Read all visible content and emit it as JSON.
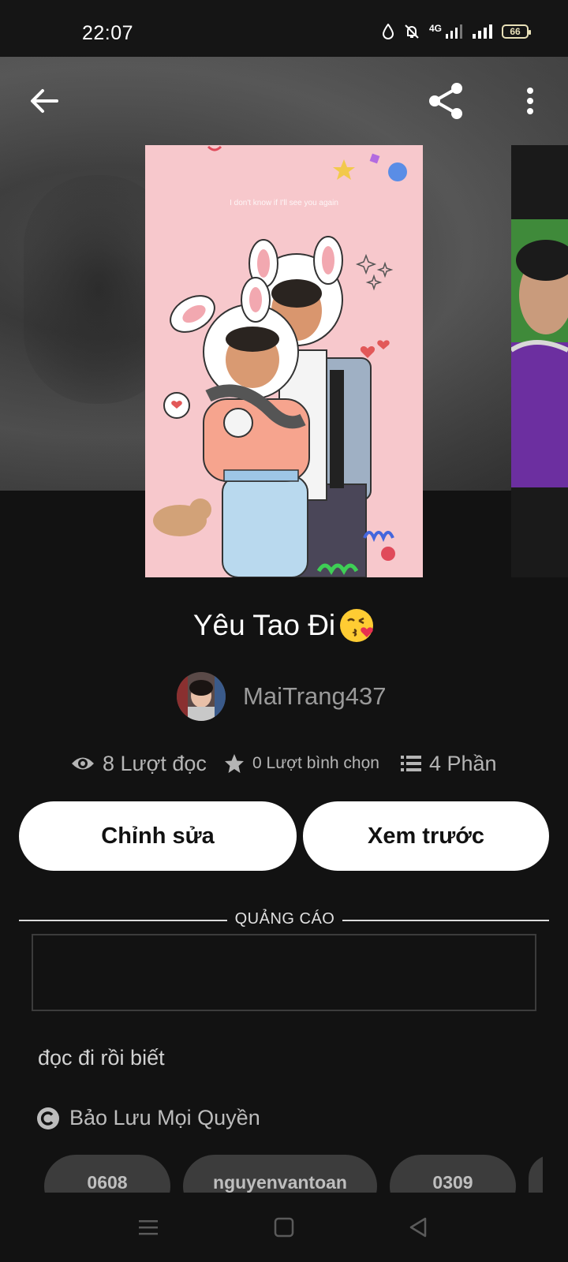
{
  "status_bar": {
    "time": "22:07",
    "network": "4G",
    "battery": "66"
  },
  "top_nav": {
    "back_icon": "arrow-left-icon",
    "share_icon": "share-icon",
    "more_icon": "more-vertical-icon"
  },
  "cover": {
    "caption": "I don't know if I'll see you again"
  },
  "story": {
    "title": "Yêu Tao Đi",
    "title_emoji": "kissing-face-heart-emoji",
    "author": "MaiTrang437",
    "reads_label": "8 Lượt đọc",
    "votes_label": "0 Lượt bình chọn",
    "parts_label": "4 Phần",
    "description": "đọc đi rồi biết",
    "copyright": "Bảo Lưu Mọi Quyền"
  },
  "actions": {
    "edit_label": "Chỉnh sửa",
    "preview_label": "Xem trước"
  },
  "ad": {
    "label": "QUẢNG CÁO"
  },
  "tags": [
    "0608",
    "nguyenvantoan",
    "0309"
  ],
  "colors": {
    "background": "#121212",
    "button_bg": "#ffffff",
    "tag_bg": "#3c3c3c",
    "muted_text": "#9a9a9a"
  }
}
